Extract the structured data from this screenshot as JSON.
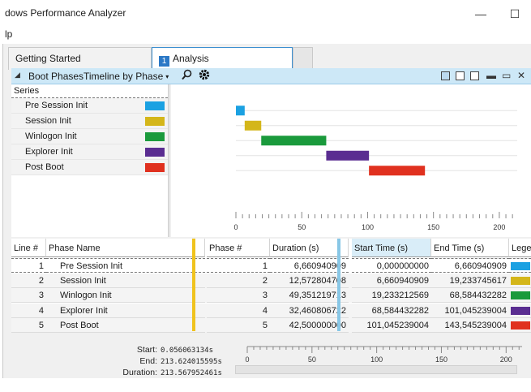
{
  "window": {
    "title": "dows Performance Analyzer",
    "minimize_glyph": "—",
    "maximize_glyph": "☐"
  },
  "menu": {
    "items": [
      "lp"
    ]
  },
  "tabs": [
    {
      "label": "Getting Started"
    },
    {
      "label": "Analysis",
      "badge": "1"
    }
  ],
  "panel": {
    "title": "Boot Phases",
    "preset": "Timeline by Phase",
    "collapse_glyph": "◢",
    "dropdown_glyph": "▾",
    "icons": [
      "search-icon",
      "gear-icon",
      "view-graph-table-icon",
      "view-graph-icon",
      "view-table-icon",
      "minimize-icon",
      "restore-icon",
      "close-icon"
    ]
  },
  "series_panel": {
    "header": "Series",
    "items": [
      {
        "label": "Pre Session Init",
        "color": "#1ba1e2"
      },
      {
        "label": "Session Init",
        "color": "#d4b61a"
      },
      {
        "label": "Winlogon Init",
        "color": "#1a9a3c"
      },
      {
        "label": "Explorer Init",
        "color": "#5a2d91"
      },
      {
        "label": "Post Boot",
        "color": "#e0311f"
      }
    ]
  },
  "chart_data": {
    "type": "bar",
    "orientation": "horizontal-gantt",
    "categories": [
      "Pre Session Init",
      "Session Init",
      "Winlogon Init",
      "Explorer Init",
      "Post Boot"
    ],
    "start": [
      0.0,
      6.660940909,
      19.233212569,
      68.584432282,
      101.045239004
    ],
    "end": [
      6.660940909,
      19.233745617,
      68.584432282,
      101.045239004,
      143.545239004
    ],
    "colors": [
      "#1ba1e2",
      "#d4b61a",
      "#1a9a3c",
      "#5a2d91",
      "#e0311f"
    ],
    "xlim": [
      0,
      213.6
    ],
    "xticks": [
      0,
      50,
      100,
      150,
      200
    ],
    "xtick_labels": [
      "0",
      "50",
      "100",
      "150",
      "200"
    ],
    "grid": true
  },
  "table": {
    "columns": [
      "Line #",
      "Phase Name",
      "Phase #",
      "Duration (s)",
      "Start Time (s)",
      "End Time (s)",
      "Lege"
    ],
    "rows": [
      {
        "line": "1",
        "name": "Pre Session Init",
        "phase": "1",
        "duration": "6,660940909",
        "start": "0,000000000",
        "end": "6,660940909",
        "color": "#1ba1e2"
      },
      {
        "line": "2",
        "name": "Session Init",
        "phase": "2",
        "duration": "12,572804708",
        "start": "6,660940909",
        "end": "19,233745617",
        "color": "#d4b61a"
      },
      {
        "line": "3",
        "name": "Winlogon Init",
        "phase": "3",
        "duration": "49,351219713",
        "start": "19,233212569",
        "end": "68,584432282",
        "color": "#1a9a3c"
      },
      {
        "line": "4",
        "name": "Explorer Init",
        "phase": "4",
        "duration": "32,460806722",
        "start": "68,584432282",
        "end": "101,045239004",
        "color": "#5a2d91"
      },
      {
        "line": "5",
        "name": "Post Boot",
        "phase": "5",
        "duration": "42,500000000",
        "start": "101,045239004",
        "end": "143,545239004",
        "color": "#e0311f"
      }
    ]
  },
  "footer": {
    "start_label": "Start:",
    "start_value": "0.056063134s",
    "end_label": "End:",
    "end_value": "213.624015595s",
    "duration_label": "Duration:",
    "duration_value": "213.567952461s",
    "axis_ticks": [
      0,
      50,
      100,
      150,
      200
    ],
    "axis_labels": [
      "0",
      "50",
      "100",
      "150",
      "200"
    ]
  }
}
